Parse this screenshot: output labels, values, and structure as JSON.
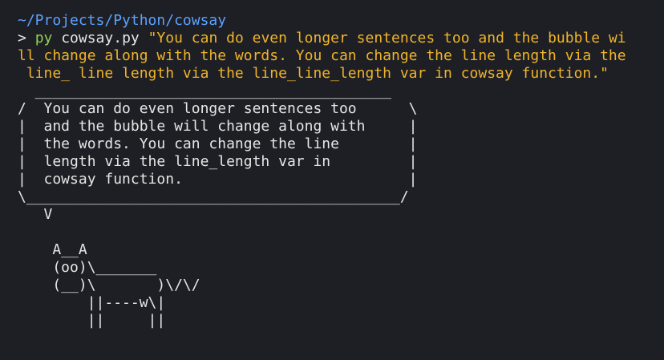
{
  "terminal": {
    "cwd": "~/Projects/Python/cowsay",
    "prompt_symbol": "> ",
    "command": "py",
    "script": " cowsay.py ",
    "arg_lines": [
      "\"You can do even longer sentences too and the bubble wi",
      "ll change along with the words. You can change the line length via the",
      " line_ line length via the line_line_length var in cowsay function.\""
    ],
    "output_lines": [
      "  _________________________________________",
      "/  You can do even longer sentences too      \\",
      "|  and the bubble will change along with     |",
      "|  the words. You can change the line        |",
      "|  length via the line_length var in         |",
      "|  cowsay function.                          |",
      "\\___________________________________________/",
      "   V",
      "",
      "    A__A",
      "    (oo)\\_______",
      "    (__)\\       )\\/\\/",
      "        ||----w\\|",
      "        ||     ||"
    ]
  },
  "colors": {
    "background": "#1e1f25",
    "path": "#5aa2ff",
    "command": "#8fd14f",
    "string": "#f0b429",
    "text": "#e6e6e6"
  }
}
